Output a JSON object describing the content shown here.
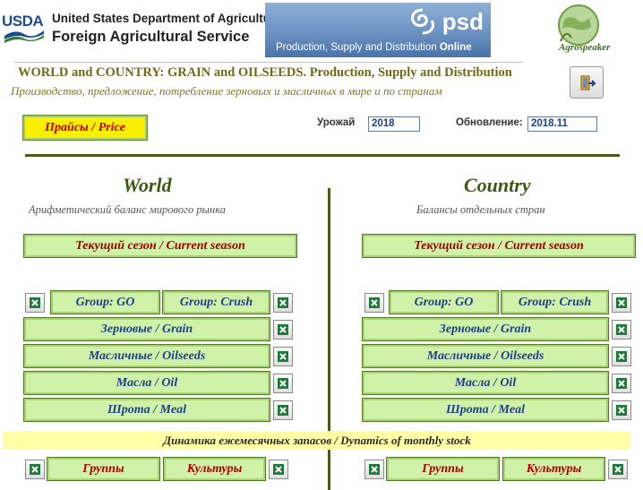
{
  "header": {
    "usda_abbr": "USDA",
    "usda_dept": "United States Department of Agriculture",
    "usda_service": "Foreign Agricultural Service",
    "psd_logo": "psd",
    "psd_caption": "Production, Supply and Distribution",
    "psd_caption_bold": "Online",
    "agro_logo": "Agrospeaker",
    "title_en": "WORLD and COUNTRY:  GRAIN and OILSEEDS. Production, Supply and Distribution",
    "title_ru": "Производство, предложение, потребление зерновых и масличных в мире и по странам"
  },
  "controls": {
    "price_label": "Прайсы / Price",
    "harvest_label": "Урожай",
    "harvest_value": "2018",
    "update_label": "Обновление:",
    "update_value": "2018.11"
  },
  "world": {
    "heading": "World",
    "subheading": "Арифметический баланс мирового рынка",
    "season": "Текущий сезон / Current season",
    "group_go": "Group: GO",
    "group_crush": "Group: Crush",
    "grain": "Зерновые / Grain",
    "oilseeds": "Масличные / Oilseeds",
    "oil": "Масла / Oil",
    "meal": "Шрота / Meal",
    "groups": "Группы",
    "crops": "Культуры"
  },
  "country": {
    "heading": "Country",
    "subheading": "Балансы отдельных стран",
    "season": "Текущий сезон / Current season",
    "group_go": "Group: GO",
    "group_crush": "Group: Crush",
    "grain": "Зерновые / Grain",
    "oilseeds": "Масличные / Oilseeds",
    "oil": "Масла / Oil",
    "meal": "Шрота / Meal",
    "groups": "Группы",
    "crops": "Культуры"
  },
  "dynamics_label": "Динамика ежемесячных запасов / Dynamics of monthly stock",
  "colors": {
    "button_fill": "#cff2a8",
    "price_fill": "#f8f000",
    "heading": "#3d5a14",
    "rule": "#4a5a1a",
    "dynamics_fill": "#ffffa6"
  },
  "icons": {
    "excel": "excel-icon",
    "exit": "exit-door-icon"
  }
}
